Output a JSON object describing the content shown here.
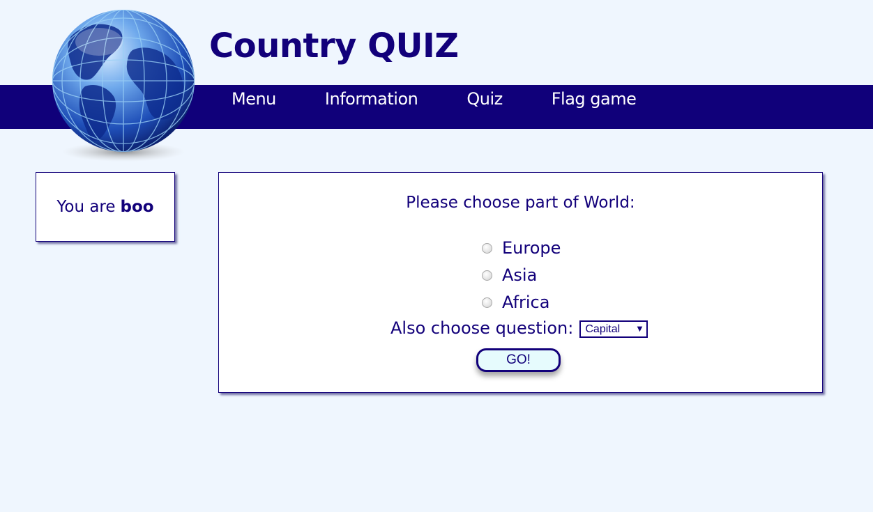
{
  "site": {
    "title": "Country QUIZ"
  },
  "nav": {
    "items": [
      {
        "label": "Menu"
      },
      {
        "label": "Information"
      },
      {
        "label": "Quiz"
      },
      {
        "label": "Flag game"
      }
    ]
  },
  "user": {
    "prefix": "You are",
    "name": "boo"
  },
  "quiz": {
    "heading": "Please choose part of World:",
    "options": [
      {
        "label": "Europe",
        "selected": false
      },
      {
        "label": "Asia",
        "selected": false
      },
      {
        "label": "Africa",
        "selected": false
      }
    ],
    "question_label": "Also choose question:",
    "question_select": {
      "value": "Capital"
    },
    "go_label": "GO!"
  },
  "icons": {
    "globe": "globe-icon",
    "select_arrow": "chevron-down-icon"
  },
  "colors": {
    "page_background": "#eff6fe",
    "nav_background": "#10007a",
    "text": "#12007a",
    "button_background": "#e6fbfd"
  }
}
